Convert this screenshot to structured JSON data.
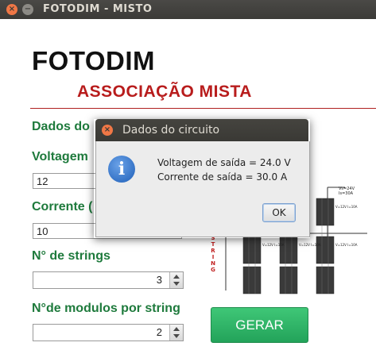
{
  "window": {
    "title": "FOTODIM - MISTO",
    "close_symbol": "×",
    "minimize_symbol": "−"
  },
  "app": {
    "title": "FOTODIM",
    "subtitle": "ASSOCIAÇÃO MISTA",
    "section_label": "Dados do",
    "voltage_label": "Voltagem",
    "voltage_value": "12",
    "current_label": "Corrente (",
    "current_value": "10",
    "strings_label": "N° de strings",
    "strings_value": "3",
    "modules_label": "N°de modulos por string",
    "modules_value": "2",
    "generate_button": "GERAR"
  },
  "diagram": {
    "string_text": "S\nT\nR\nI\nN\nG",
    "out_text": "Vs=24V\nIs=30A",
    "module_text": "V=12V\nI=10A",
    "string_text_color": "#c02020"
  },
  "dialog": {
    "title": "Dados do circuito",
    "close_symbol": "×",
    "icon": "info-icon",
    "icon_glyph": "i",
    "line1": "Voltagem de saída = 24.0 V",
    "line2": "Corrente de saída = 30.0 A",
    "ok_button": "OK"
  },
  "colors": {
    "label_green": "#1e7a3c",
    "subtitle_red": "#b81c1c",
    "button_green": "#2fb466",
    "titlebar": "#3b3a37"
  }
}
